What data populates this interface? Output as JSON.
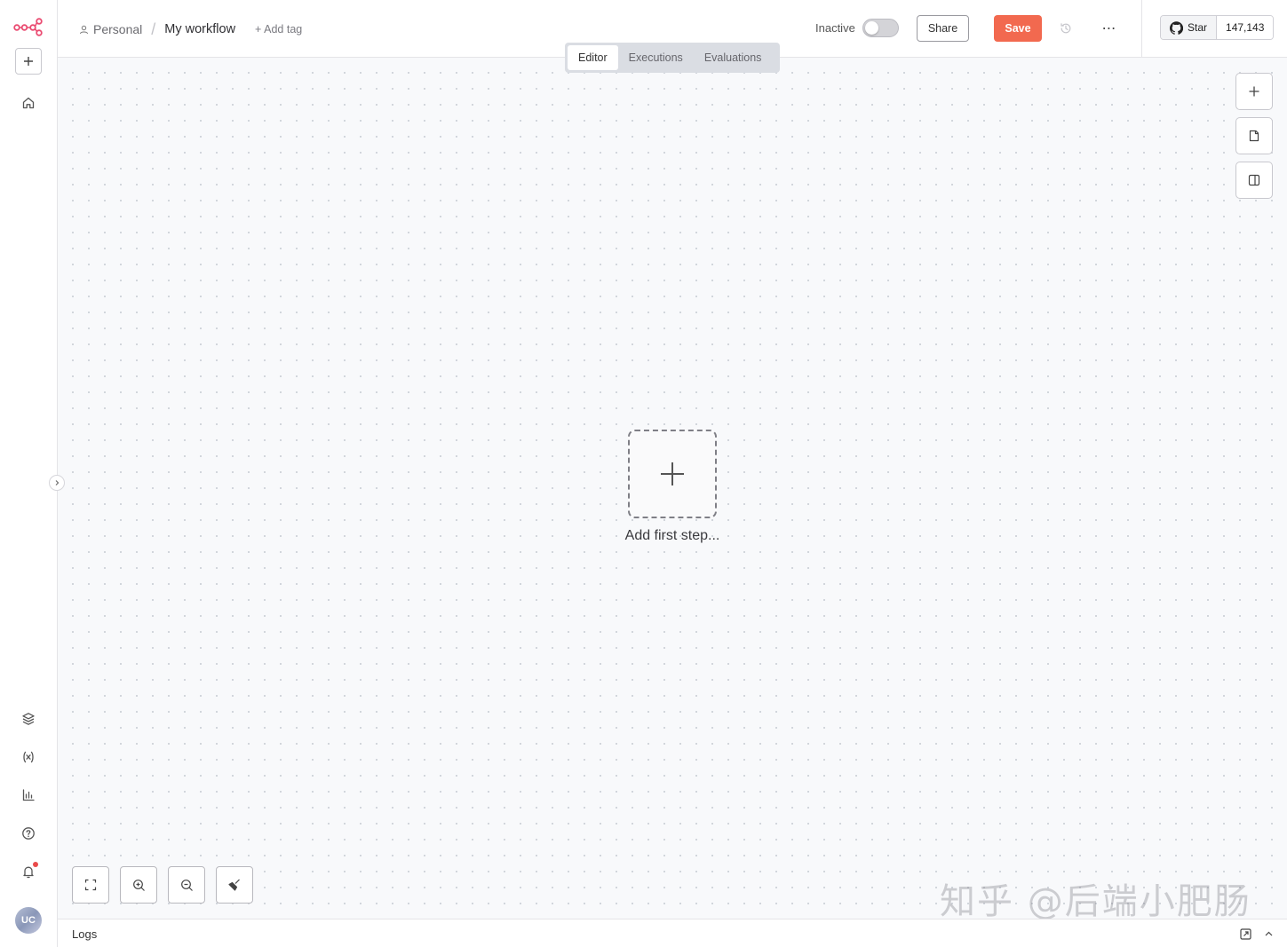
{
  "sidebar": {
    "avatar_initials": "UC"
  },
  "header": {
    "project": "Personal",
    "workflow_name": "My workflow",
    "add_tag": "+ Add tag",
    "status_label": "Inactive",
    "active": false,
    "share_label": "Share",
    "save_label": "Save",
    "more_label": "⋯",
    "github": {
      "star_label": "Star",
      "star_count": "147,143"
    }
  },
  "tabs": [
    {
      "label": "Editor",
      "active": true
    },
    {
      "label": "Executions",
      "active": false
    },
    {
      "label": "Evaluations",
      "active": false
    }
  ],
  "canvas": {
    "add_first_step": "Add first step..."
  },
  "watermark": "知乎 @后端小肥肠",
  "logs": {
    "label": "Logs"
  },
  "colors": {
    "accent": "#f2694f",
    "logo": "#ea4b71"
  }
}
